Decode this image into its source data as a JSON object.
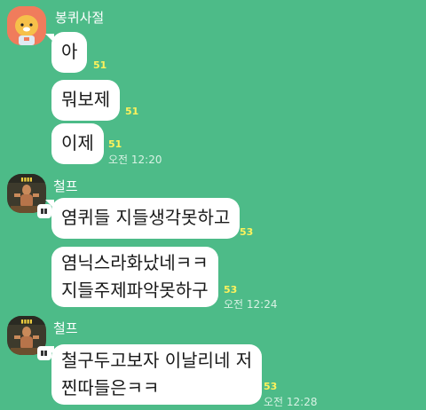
{
  "senders": {
    "first": "봉퀴사절",
    "second": "철프",
    "third": "철프"
  },
  "messages": [
    {
      "text": "아",
      "unread": "51",
      "time": ""
    },
    {
      "text": "뭐보제",
      "unread": "51",
      "time": ""
    },
    {
      "text": "이제",
      "unread": "51",
      "time": "오전 12:20"
    },
    {
      "text": "염퀴들 지들생각못하고",
      "unread": "53",
      "time": ""
    },
    {
      "text": "염닉스라화났네ㅋㅋ\n지들주제파악못하구",
      "unread": "53",
      "time": "오전 12:24"
    },
    {
      "text": "철구두고보자 이날리네 저\n찐따들은ㅋㅋ",
      "unread": "53",
      "time": "오전 12:28"
    }
  ],
  "icons": {
    "avatar_first": "cartoon-lion-avatar",
    "avatar_second": "photo-avatar",
    "photo_badge": "gallery-icon"
  },
  "colors": {
    "background": "#4dbb88",
    "bubble": "#ffffff",
    "unread": "#fff25c"
  }
}
